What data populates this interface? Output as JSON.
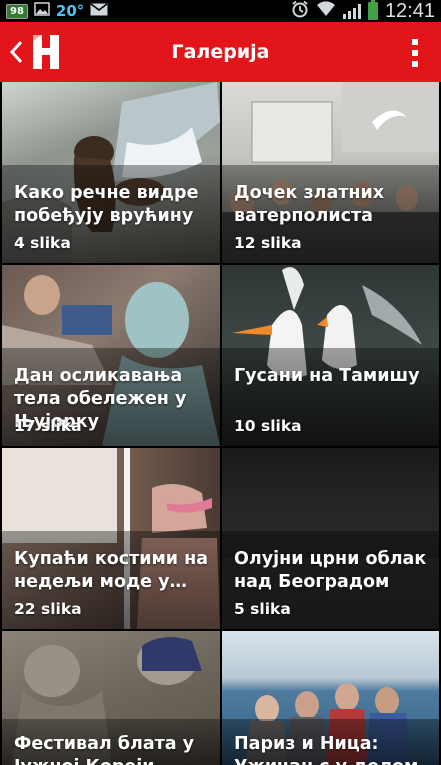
{
  "status_bar": {
    "battery_badge": "98",
    "temperature": "20°",
    "time": "12:41"
  },
  "app_bar": {
    "logo_letter": "H",
    "title": "Галерија"
  },
  "gallery": [
    {
      "title": "Како речне видре побеђују врућину",
      "count": "4 slika"
    },
    {
      "title": "Дочек златних ватерполиста",
      "count": "12 slika"
    },
    {
      "title": "Дан осликавања тела обележен у Њујорку",
      "count": "17 slika"
    },
    {
      "title": "Гусани на Тамишу",
      "count": "10 slika"
    },
    {
      "title": "Купаћи костими на недељи моде у…",
      "count": "22 slika"
    },
    {
      "title": "Олујни црни облак над Београдом",
      "count": "5 slika"
    },
    {
      "title": "Фестивал блата у Јужној Кореји",
      "count": ""
    },
    {
      "title": "Париз и Ница: Ужичан с у делом",
      "count": ""
    }
  ],
  "colors": {
    "accent": "#e2151b",
    "status_bar": "#000000",
    "temperature": "#4fc3f7",
    "battery": "#43a047"
  }
}
